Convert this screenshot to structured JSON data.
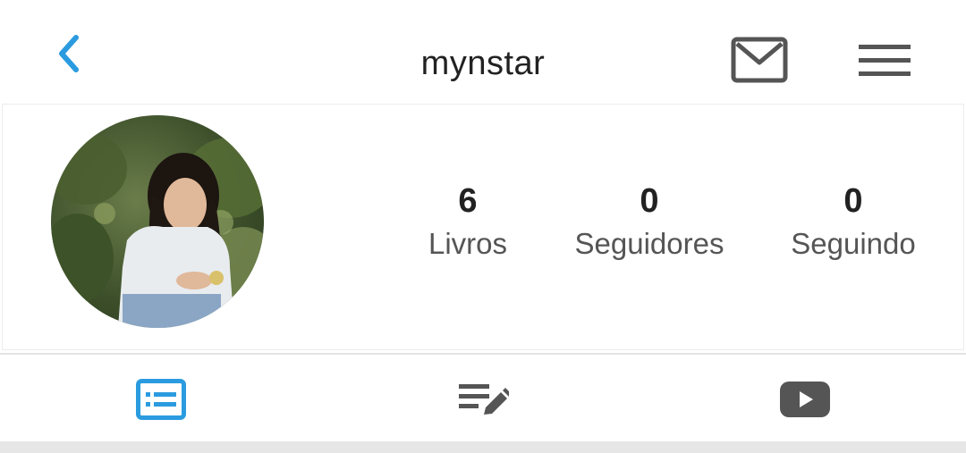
{
  "header": {
    "username": "mynstar",
    "icons": {
      "back": "chevron-left-icon",
      "messages": "mail-icon",
      "menu": "hamburger-menu-icon"
    },
    "accent_color": "#2b9be0",
    "icon_color": "#555555"
  },
  "profile": {
    "avatar": "profile-photo",
    "stats": [
      {
        "value": "6",
        "label": "Livros"
      },
      {
        "value": "0",
        "label": "Seguidores"
      },
      {
        "value": "0",
        "label": "Seguindo"
      }
    ]
  },
  "tabs": [
    {
      "icon": "profile-info-card-icon",
      "active": true
    },
    {
      "icon": "reading-list-edit-icon",
      "active": false
    },
    {
      "icon": "video-play-icon",
      "active": false
    }
  ]
}
